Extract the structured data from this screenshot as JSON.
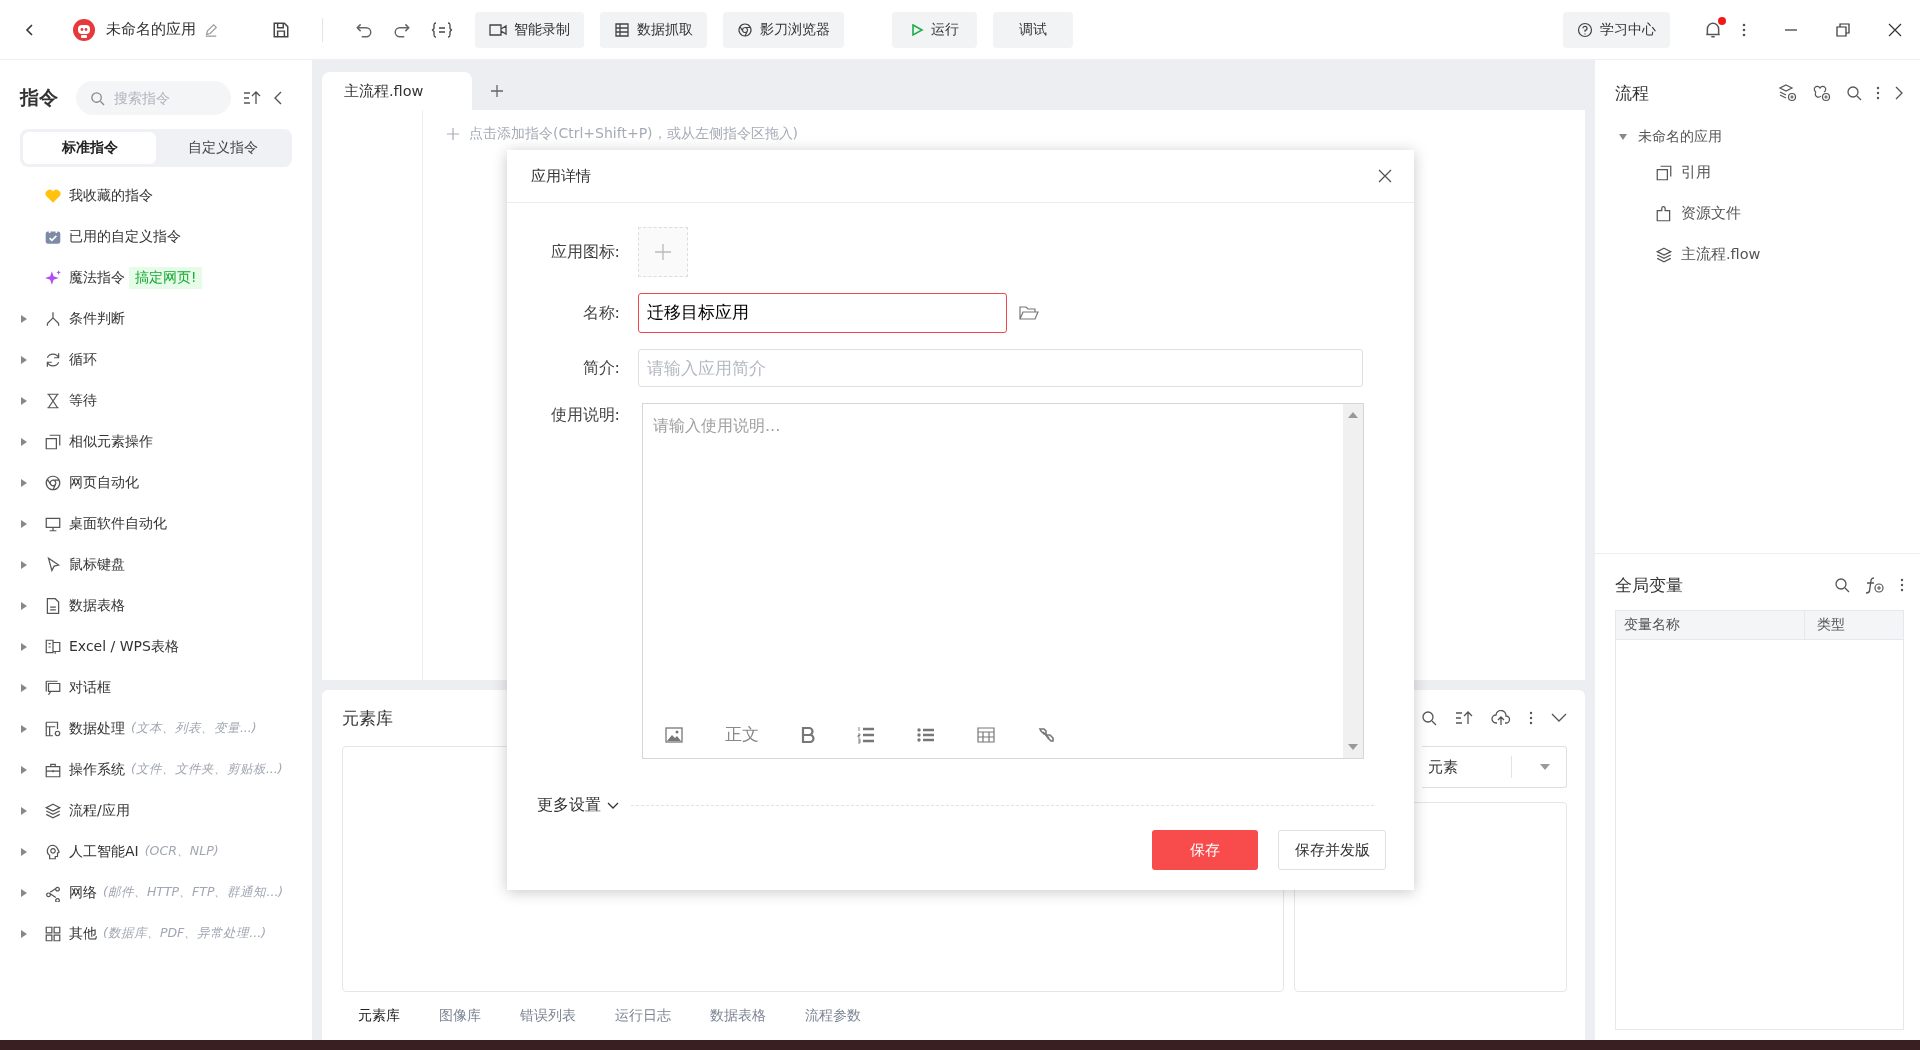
{
  "topbar": {
    "title": "未命名的应用",
    "tools": [
      {
        "label": "智能录制"
      },
      {
        "label": "数据抓取"
      },
      {
        "label": "影刀浏览器"
      }
    ],
    "run": "运行",
    "debug": "调试",
    "help": "学习中心",
    "notification_dot": true
  },
  "sidebar": {
    "title": "指令",
    "search_placeholder": "搜索指令",
    "tabs": [
      {
        "label": "标准指令",
        "selected": true
      },
      {
        "label": "自定义指令",
        "selected": false
      }
    ],
    "items": [
      {
        "kind": "favorite",
        "label": "我收藏的指令"
      },
      {
        "kind": "custom",
        "label": "已用的自定义指令"
      },
      {
        "kind": "magic",
        "label": "魔法指令",
        "badge": "搞定网页!"
      },
      {
        "kind": "group",
        "label": "条件判断",
        "expanded": false
      },
      {
        "kind": "group",
        "label": "循环",
        "expanded": false
      },
      {
        "kind": "group",
        "label": "等待",
        "expanded": false
      },
      {
        "kind": "group",
        "label": "相似元素操作",
        "expanded": false
      },
      {
        "kind": "group",
        "label": "网页自动化",
        "expanded": false
      },
      {
        "kind": "group",
        "label": "桌面软件自动化",
        "expanded": false
      },
      {
        "kind": "group",
        "label": "鼠标键盘",
        "expanded": false
      },
      {
        "kind": "group",
        "label": "数据表格",
        "expanded": false
      },
      {
        "kind": "group",
        "label": "Excel / WPS表格",
        "expanded": false
      },
      {
        "kind": "group",
        "label": "对话框",
        "expanded": false
      },
      {
        "kind": "group",
        "label": "数据处理",
        "hint": "(文本、列表、变量...)",
        "expanded": false
      },
      {
        "kind": "group",
        "label": "操作系统",
        "hint": "(文件、文件夹、剪贴板...)",
        "expanded": false
      },
      {
        "kind": "group",
        "label": "流程/应用",
        "expanded": false
      },
      {
        "kind": "group",
        "label": "人工智能AI",
        "hint": "(OCR、NLP)",
        "expanded": false
      },
      {
        "kind": "group",
        "label": "网络",
        "hint": "(邮件、HTTP、FTP、群通知...)",
        "expanded": false
      },
      {
        "kind": "group",
        "label": "其他",
        "hint": "(数据库、PDF、异常处理...)",
        "expanded": false
      }
    ]
  },
  "editor": {
    "tabs": [
      {
        "label": "主流程.flow",
        "selected": true
      }
    ],
    "hint": "点击添加指令(Ctrl+Shift+P)，或从左侧指令区拖入)"
  },
  "element_panel": {
    "title": "元素库",
    "dropdown_value": "元素",
    "tabs": [
      {
        "label": "元素库",
        "selected": true
      },
      {
        "label": "图像库",
        "selected": false
      },
      {
        "label": "错误列表",
        "selected": false
      },
      {
        "label": "运行日志",
        "selected": false
      },
      {
        "label": "数据表格",
        "selected": false
      },
      {
        "label": "流程参数",
        "selected": false
      }
    ]
  },
  "flow_panel": {
    "title": "流程",
    "root": {
      "label": "未命名的应用",
      "expanded": true,
      "children": [
        {
          "label": "引用"
        },
        {
          "label": "资源文件"
        },
        {
          "label": "主流程.flow"
        }
      ]
    }
  },
  "variables_panel": {
    "title": "全局变量",
    "columns": [
      "变量名称",
      "类型"
    ]
  },
  "dialog": {
    "title": "应用详情",
    "fields": [
      {
        "kind": "icon",
        "label": "应用图标:"
      },
      {
        "kind": "text",
        "label": "名称:",
        "value": "迁移目标应用",
        "invalid": true
      },
      {
        "kind": "text",
        "label": "简介:",
        "placeholder": "请输入应用简介",
        "invalid": false
      },
      {
        "kind": "editor",
        "label": "使用说明:",
        "placeholder": "请输入使用说明...",
        "style_label": "正文"
      }
    ],
    "more": "更多设置",
    "buttons": [
      {
        "label": "保存",
        "primary": true
      },
      {
        "label": "保存并发版",
        "primary": false
      }
    ]
  }
}
